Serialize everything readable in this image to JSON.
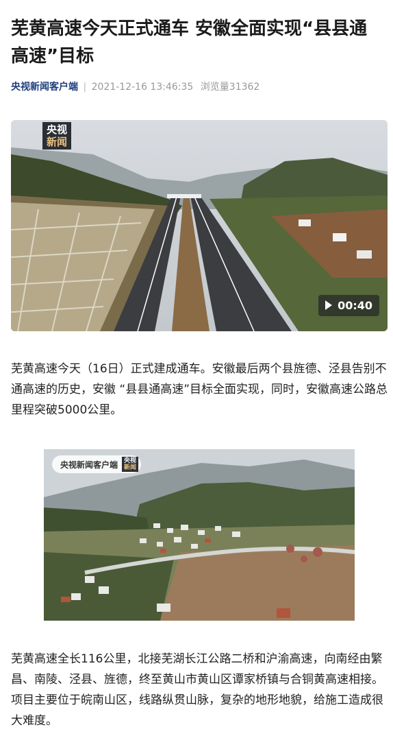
{
  "article": {
    "title": "芜黄高速今天正式通车 安徽全面实现“县县通高速”目标",
    "source": "央视新闻客户端",
    "separator": "|",
    "datetime": "2021-12-16 13:46:35",
    "views": "浏览量31362"
  },
  "video": {
    "logo_line1": "央视",
    "logo_line2": "新闻",
    "duration": "00:40",
    "icon": "play-icon"
  },
  "paragraphs": [
    "芜黄高速今天（16日）正式建成通车。安徽最后两个县旌德、泾县告别不通高速的历史，安徽 “县县通高速”目标全面实现，同时，安徽高速公路总里程突破5000公里。",
    "芜黄高速全长116公里，北接芜湖长江公路二桥和沪渝高速，向南经由繁昌、南陵、泾县、旌德，终至黄山市黄山区谭家桥镇与合铜黄高速相接。项目主要位于皖南山区，线路纵贯山脉，复杂的地形地貌，给施工造成很大难度。"
  ],
  "photo": {
    "watermark_text": "央视新闻客户端",
    "watermark_logo_line1": "央视",
    "watermark_logo_line2": "新闻"
  }
}
